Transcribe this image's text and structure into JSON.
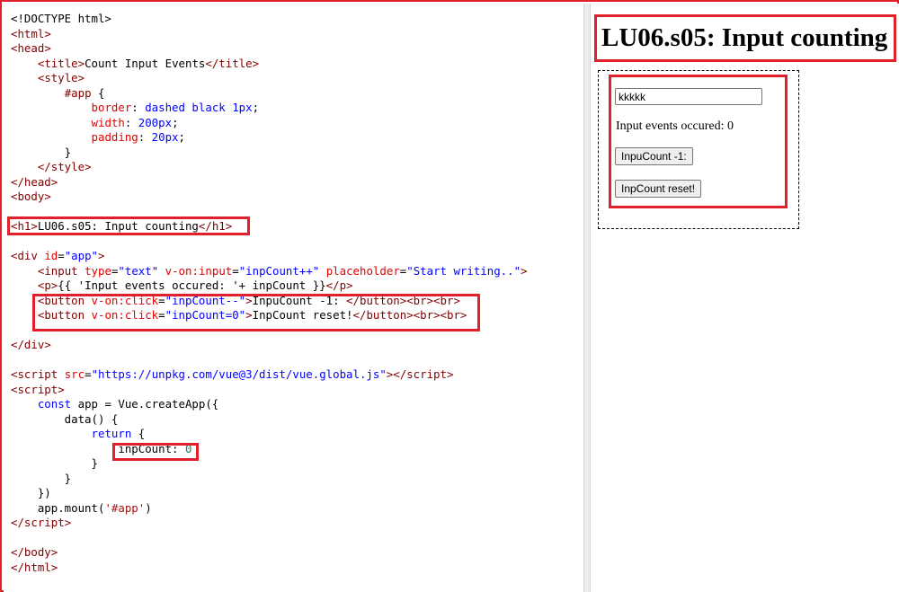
{
  "code_lines": [
    [
      [
        "t-plain",
        "<!DOCTYPE html>"
      ]
    ],
    [
      [
        "t-br",
        "<"
      ],
      [
        "t-tag",
        "html"
      ],
      [
        "t-br",
        ">"
      ]
    ],
    [
      [
        "t-br",
        "<"
      ],
      [
        "t-tag",
        "head"
      ],
      [
        "t-br",
        ">"
      ]
    ],
    [
      [
        "t-plain",
        "    "
      ],
      [
        "t-br",
        "<"
      ],
      [
        "t-tag",
        "title"
      ],
      [
        "t-br",
        ">"
      ],
      [
        "t-plain",
        "Count Input Events"
      ],
      [
        "t-br",
        "</"
      ],
      [
        "t-tag",
        "title"
      ],
      [
        "t-br",
        ">"
      ]
    ],
    [
      [
        "t-plain",
        "    "
      ],
      [
        "t-br",
        "<"
      ],
      [
        "t-tag",
        "style"
      ],
      [
        "t-br",
        ">"
      ]
    ],
    [
      [
        "t-plain",
        "        "
      ],
      [
        "t-tag",
        "#app"
      ],
      [
        "t-plain",
        " {"
      ]
    ],
    [
      [
        "t-plain",
        "            "
      ],
      [
        "t-attr",
        "border"
      ],
      [
        "t-plain",
        ": "
      ],
      [
        "t-val",
        "dashed black 1px"
      ],
      [
        "t-plain",
        ";"
      ]
    ],
    [
      [
        "t-plain",
        "            "
      ],
      [
        "t-attr",
        "width"
      ],
      [
        "t-plain",
        ": "
      ],
      [
        "t-val",
        "200px"
      ],
      [
        "t-plain",
        ";"
      ]
    ],
    [
      [
        "t-plain",
        "            "
      ],
      [
        "t-attr",
        "padding"
      ],
      [
        "t-plain",
        ": "
      ],
      [
        "t-val",
        "20px"
      ],
      [
        "t-plain",
        ";"
      ]
    ],
    [
      [
        "t-plain",
        "        }"
      ]
    ],
    [
      [
        "t-plain",
        "    "
      ],
      [
        "t-br",
        "</"
      ],
      [
        "t-tag",
        "style"
      ],
      [
        "t-br",
        ">"
      ]
    ],
    [
      [
        "t-br",
        "</"
      ],
      [
        "t-tag",
        "head"
      ],
      [
        "t-br",
        ">"
      ]
    ],
    [
      [
        "t-br",
        "<"
      ],
      [
        "t-tag",
        "body"
      ],
      [
        "t-br",
        ">"
      ]
    ],
    [],
    [
      [
        "t-br",
        "<"
      ],
      [
        "t-tag",
        "h1"
      ],
      [
        "t-br",
        ">"
      ],
      [
        "t-plain",
        "LU06.s05: Input counting"
      ],
      [
        "t-br",
        "</"
      ],
      [
        "t-tag",
        "h1"
      ],
      [
        "t-br",
        ">"
      ]
    ],
    [],
    [
      [
        "t-br",
        "<"
      ],
      [
        "t-tag",
        "div"
      ],
      [
        "t-plain",
        " "
      ],
      [
        "t-attr",
        "id"
      ],
      [
        "t-plain",
        "="
      ],
      [
        "t-val",
        "\"app\""
      ],
      [
        "t-br",
        ">"
      ]
    ],
    [
      [
        "t-plain",
        "    "
      ],
      [
        "t-br",
        "<"
      ],
      [
        "t-tag",
        "input"
      ],
      [
        "t-plain",
        " "
      ],
      [
        "t-attr",
        "type"
      ],
      [
        "t-plain",
        "="
      ],
      [
        "t-val",
        "\"text\""
      ],
      [
        "t-plain",
        " "
      ],
      [
        "t-attr",
        "v-on:input"
      ],
      [
        "t-plain",
        "="
      ],
      [
        "t-val",
        "\"inpCount++\""
      ],
      [
        "t-plain",
        " "
      ],
      [
        "t-attr",
        "placeholder"
      ],
      [
        "t-plain",
        "="
      ],
      [
        "t-val",
        "\"Start writing..\""
      ],
      [
        "t-br",
        ">"
      ]
    ],
    [
      [
        "t-plain",
        "    "
      ],
      [
        "t-br",
        "<"
      ],
      [
        "t-tag",
        "p"
      ],
      [
        "t-br",
        ">"
      ],
      [
        "t-plain",
        "{{ 'Input events occured: '+ inpCount }}"
      ],
      [
        "t-br",
        "</"
      ],
      [
        "t-tag",
        "p"
      ],
      [
        "t-br",
        ">"
      ]
    ],
    [
      [
        "t-plain",
        "    "
      ],
      [
        "t-br",
        "<"
      ],
      [
        "t-tag",
        "button"
      ],
      [
        "t-plain",
        " "
      ],
      [
        "t-attr",
        "v-on:click"
      ],
      [
        "t-plain",
        "="
      ],
      [
        "t-val",
        "\"inpCount--\""
      ],
      [
        "t-br",
        ">"
      ],
      [
        "t-plain",
        "InpuCount -1: "
      ],
      [
        "t-br",
        "</"
      ],
      [
        "t-tag",
        "button"
      ],
      [
        "t-br",
        "><"
      ],
      [
        "t-tag",
        "br"
      ],
      [
        "t-br",
        "><"
      ],
      [
        "t-tag",
        "br"
      ],
      [
        "t-br",
        ">"
      ]
    ],
    [
      [
        "t-plain",
        "    "
      ],
      [
        "t-br",
        "<"
      ],
      [
        "t-tag",
        "button"
      ],
      [
        "t-plain",
        " "
      ],
      [
        "t-attr",
        "v-on:click"
      ],
      [
        "t-plain",
        "="
      ],
      [
        "t-val",
        "\"inpCount=0\""
      ],
      [
        "t-br",
        ">"
      ],
      [
        "t-plain",
        "InpCount reset!"
      ],
      [
        "t-br",
        "</"
      ],
      [
        "t-tag",
        "button"
      ],
      [
        "t-br",
        "><"
      ],
      [
        "t-tag",
        "br"
      ],
      [
        "t-br",
        "><"
      ],
      [
        "t-tag",
        "br"
      ],
      [
        "t-br",
        ">"
      ]
    ],
    [],
    [
      [
        "t-br",
        "</"
      ],
      [
        "t-tag",
        "div"
      ],
      [
        "t-br",
        ">"
      ]
    ],
    [],
    [
      [
        "t-br",
        "<"
      ],
      [
        "t-tag",
        "script"
      ],
      [
        "t-plain",
        " "
      ],
      [
        "t-attr",
        "src"
      ],
      [
        "t-plain",
        "="
      ],
      [
        "t-val",
        "\"https://unpkg.com/vue@3/dist/vue.global.js\""
      ],
      [
        "t-br",
        "></"
      ],
      [
        "t-tag",
        "script"
      ],
      [
        "t-br",
        ">"
      ]
    ],
    [
      [
        "t-br",
        "<"
      ],
      [
        "t-tag",
        "script"
      ],
      [
        "t-br",
        ">"
      ]
    ],
    [
      [
        "t-plain",
        "    "
      ],
      [
        "t-kw",
        "const"
      ],
      [
        "t-plain",
        " app = Vue.createApp({"
      ]
    ],
    [
      [
        "t-plain",
        "        data() {"
      ]
    ],
    [
      [
        "t-plain",
        "            "
      ],
      [
        "t-kw",
        "return"
      ],
      [
        "t-plain",
        " {"
      ]
    ],
    [
      [
        "t-plain",
        "                inpCount: "
      ],
      [
        "t-num",
        "0"
      ]
    ],
    [
      [
        "t-plain",
        "            }"
      ]
    ],
    [
      [
        "t-plain",
        "        }"
      ]
    ],
    [
      [
        "t-plain",
        "    })"
      ]
    ],
    [
      [
        "t-plain",
        "    app.mount("
      ],
      [
        "t-str",
        "'#app'"
      ],
      [
        "t-plain",
        ")"
      ]
    ],
    [
      [
        "t-br",
        "</"
      ],
      [
        "t-tag",
        "script"
      ],
      [
        "t-br",
        ">"
      ]
    ],
    [],
    [
      [
        "t-br",
        "</"
      ],
      [
        "t-tag",
        "body"
      ],
      [
        "t-br",
        ">"
      ]
    ],
    [
      [
        "t-br",
        "</"
      ],
      [
        "t-tag",
        "html"
      ],
      [
        "t-br",
        ">"
      ]
    ]
  ],
  "result": {
    "title": "LU06.s05: Input counting",
    "input_value": "kkkkk",
    "input_placeholder": "Start writing..",
    "events_text": "Input events occured: 0",
    "decrement_label": "InpuCount -1:",
    "reset_label": "InpCount reset!"
  },
  "colors": {
    "highlight": "#e0202a",
    "tag": "#800000",
    "attribute": "#e50000",
    "value": "#0000ff",
    "number": "#098658"
  }
}
